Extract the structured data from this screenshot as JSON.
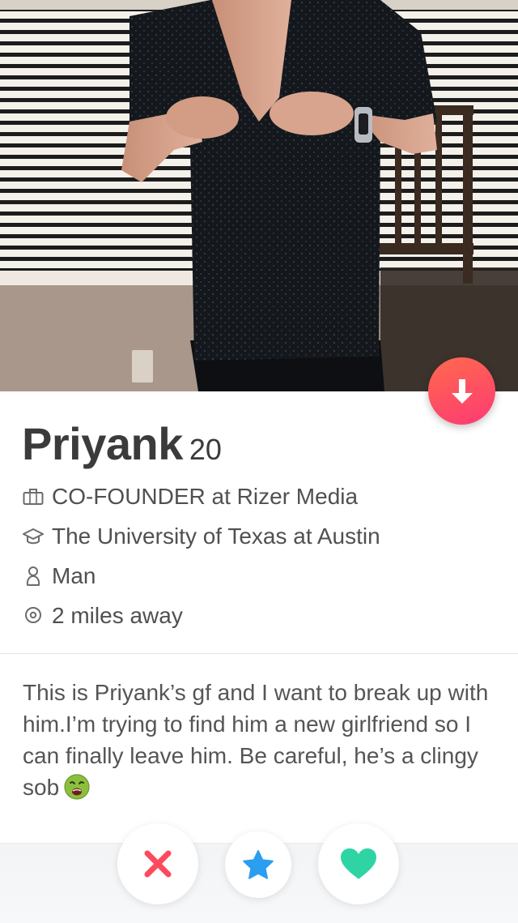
{
  "profile": {
    "name": "Priyank",
    "age": "20",
    "job": "CO-FOUNDER at Rizer Media",
    "school": "The University of Texas at Austin",
    "gender": "Man",
    "distance": "2 miles away",
    "bio": "This is Priyank’s gf and I want to break up with him.I’m trying to find him a new girlfriend so I can finally leave him. Be careful, he’s a clingy sob"
  },
  "icons": {
    "collapse": "arrow-down-icon",
    "job": "briefcase-icon",
    "school": "graduation-cap-icon",
    "gender": "person-icon",
    "distance": "location-pin-icon",
    "bio_emoji": "nauseated-face-icon",
    "nope": "close-x-icon",
    "super_like": "star-icon",
    "like": "heart-icon"
  },
  "colors": {
    "accent_gradient_start": "#ff6a4d",
    "accent_gradient_end": "#fd3a73",
    "nope": "#fd4a5c",
    "super_like": "#2b9ef0",
    "like": "#2ed4a4"
  }
}
